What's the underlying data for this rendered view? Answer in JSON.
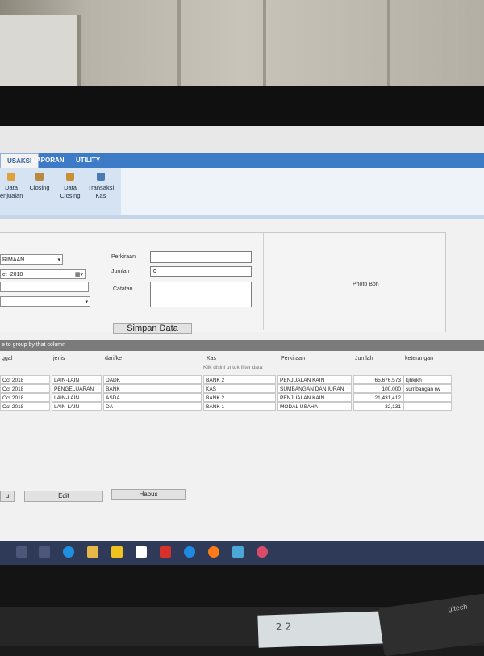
{
  "tabs": [
    {
      "label": "USAKSI",
      "active": true
    },
    {
      "label": "LAPORAN",
      "active": false
    },
    {
      "label": "UTILITY",
      "active": false
    }
  ],
  "ribbon": [
    {
      "label": "Data\nenjualan",
      "icon": "data-penjualan-icon"
    },
    {
      "label": "Closing",
      "icon": "closing-icon"
    },
    {
      "label": "Data\nClosing",
      "icon": "data-closing-icon"
    },
    {
      "label": "Transaksi\nKas",
      "icon": "transaksi-kas-icon"
    }
  ],
  "form": {
    "type_value": "RIMAAN",
    "date_value": "ct -2018",
    "perkiraan_label": "Perkiraan",
    "jumlah_label": "Jumlah",
    "jumlah_value": "0",
    "catatan_label": "Catatan",
    "photo_label": "Photo Bon",
    "save_label": "Simpan Data"
  },
  "grid": {
    "group_hint": "e to group by that column",
    "filter_hint": "Klik disini untuk filter data",
    "columns": [
      "ggal",
      "jenis",
      "dari/ke",
      "Kas",
      "Perkiraan",
      "Jumlah",
      "keterangan"
    ],
    "rows": [
      {
        "tanggal": "Oct 2018",
        "jenis": "LAIN-LAIN",
        "dari": "DADK",
        "kas": "BANK 2",
        "perkiraan": "PENJUALAN KAIN",
        "jumlah": "65,676,573",
        "keterangan": "kjhkjkh"
      },
      {
        "tanggal": "Oct 2018",
        "jenis": "PENGELUARAN",
        "dari": "BANK",
        "kas": "KAS",
        "perkiraan": "SUMBANGAN DAN IURAN",
        "jumlah": "100,000",
        "keterangan": "sumbangan rw"
      },
      {
        "tanggal": "Oct 2018",
        "jenis": "LAIN-LAIN",
        "dari": "ASDA",
        "kas": "BANK 2",
        "perkiraan": "PENJUALAN KAIN",
        "jumlah": "21,431,412",
        "keterangan": ""
      },
      {
        "tanggal": "Oct 2018",
        "jenis": "LAIN-LAIN",
        "dari": "DA",
        "kas": "BANK 1",
        "perkiraan": "MODAL USAHA",
        "jumlah": "32,131",
        "keterangan": ""
      }
    ]
  },
  "actions": {
    "baru_label": "u",
    "edit_label": "Edit",
    "hapus_label": "Hapus"
  },
  "taskbar": {
    "icons": [
      "start-icon",
      "task-view-icon",
      "edge-icon",
      "file-explorer-icon",
      "store-icon",
      "mail-icon",
      "app-icon",
      "teamviewer-icon",
      "firefox-icon",
      "outlook-icon",
      "active-app-icon"
    ]
  },
  "desk": {
    "scribble": "2 2"
  },
  "keyboard": {
    "brand": "gitech"
  }
}
